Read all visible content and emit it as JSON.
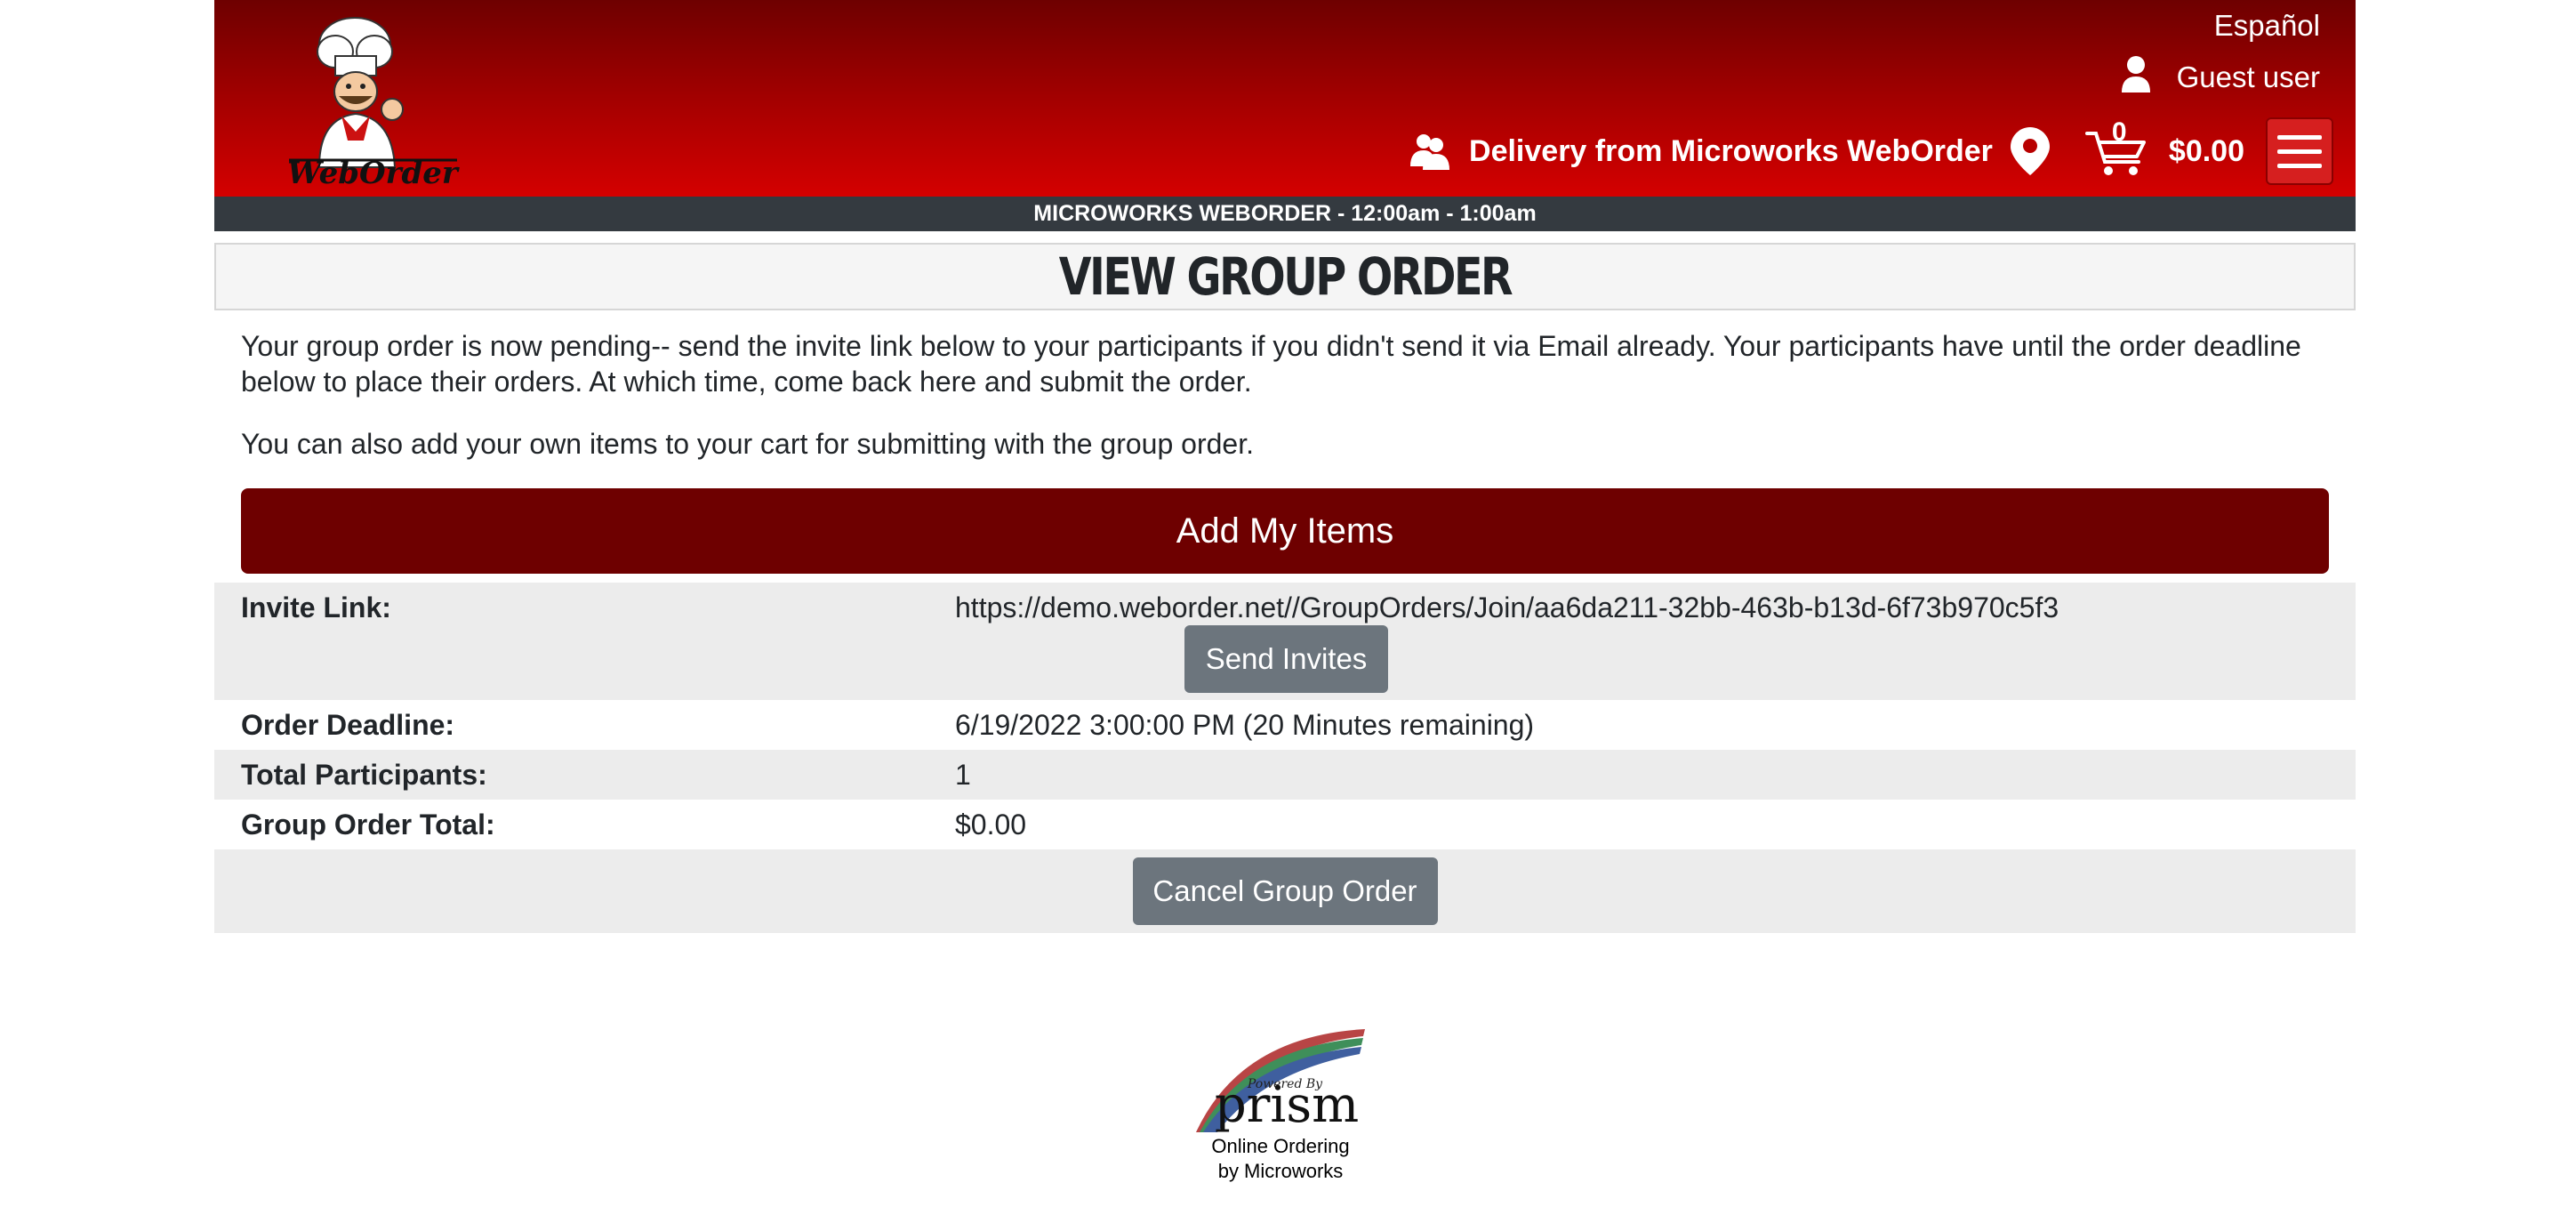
{
  "header": {
    "language_link": "Español",
    "user_label": "Guest user",
    "delivery_text": "Delivery from Microworks WebOrder",
    "cart_count": "0",
    "cart_total": "$0.00",
    "logo_text": "WebOrder",
    "store_bar": "MICROWORKS WEBORDER - 12:00am - 1:00am"
  },
  "page": {
    "title": "VIEW GROUP ORDER",
    "intro_1": "Your group order is now pending-- send the invite link below to your participants if you didn't send it via Email already. Your participants have until the order deadline below to place their orders. At which time, come back here and submit the order.",
    "intro_2": "You can also add your own items to your cart for submitting with the group order.",
    "add_items_label": "Add My Items"
  },
  "details": {
    "invite_label": "Invite Link:",
    "invite_url": "https://demo.weborder.net//GroupOrders/Join/aa6da211-32bb-463b-b13d-6f73b970c5f3",
    "send_invites_label": "Send Invites",
    "deadline_label": "Order Deadline:",
    "deadline_value": "6/19/2022 3:00:00 PM (20 Minutes remaining)",
    "participants_label": "Total Participants:",
    "participants_value": "1",
    "total_label": "Group Order Total:",
    "total_value": "$0.00",
    "cancel_label": "Cancel Group Order"
  },
  "footer": {
    "logo_small": "Powered By",
    "logo_text": "prism",
    "line1": "Online Ordering",
    "line2": "by Microworks"
  },
  "colors": {
    "header_dark": "#6e0000",
    "header_light": "#d40000",
    "primary_button": "#6e0000",
    "secondary_button": "#6c757d",
    "store_bar": "#343a40"
  }
}
